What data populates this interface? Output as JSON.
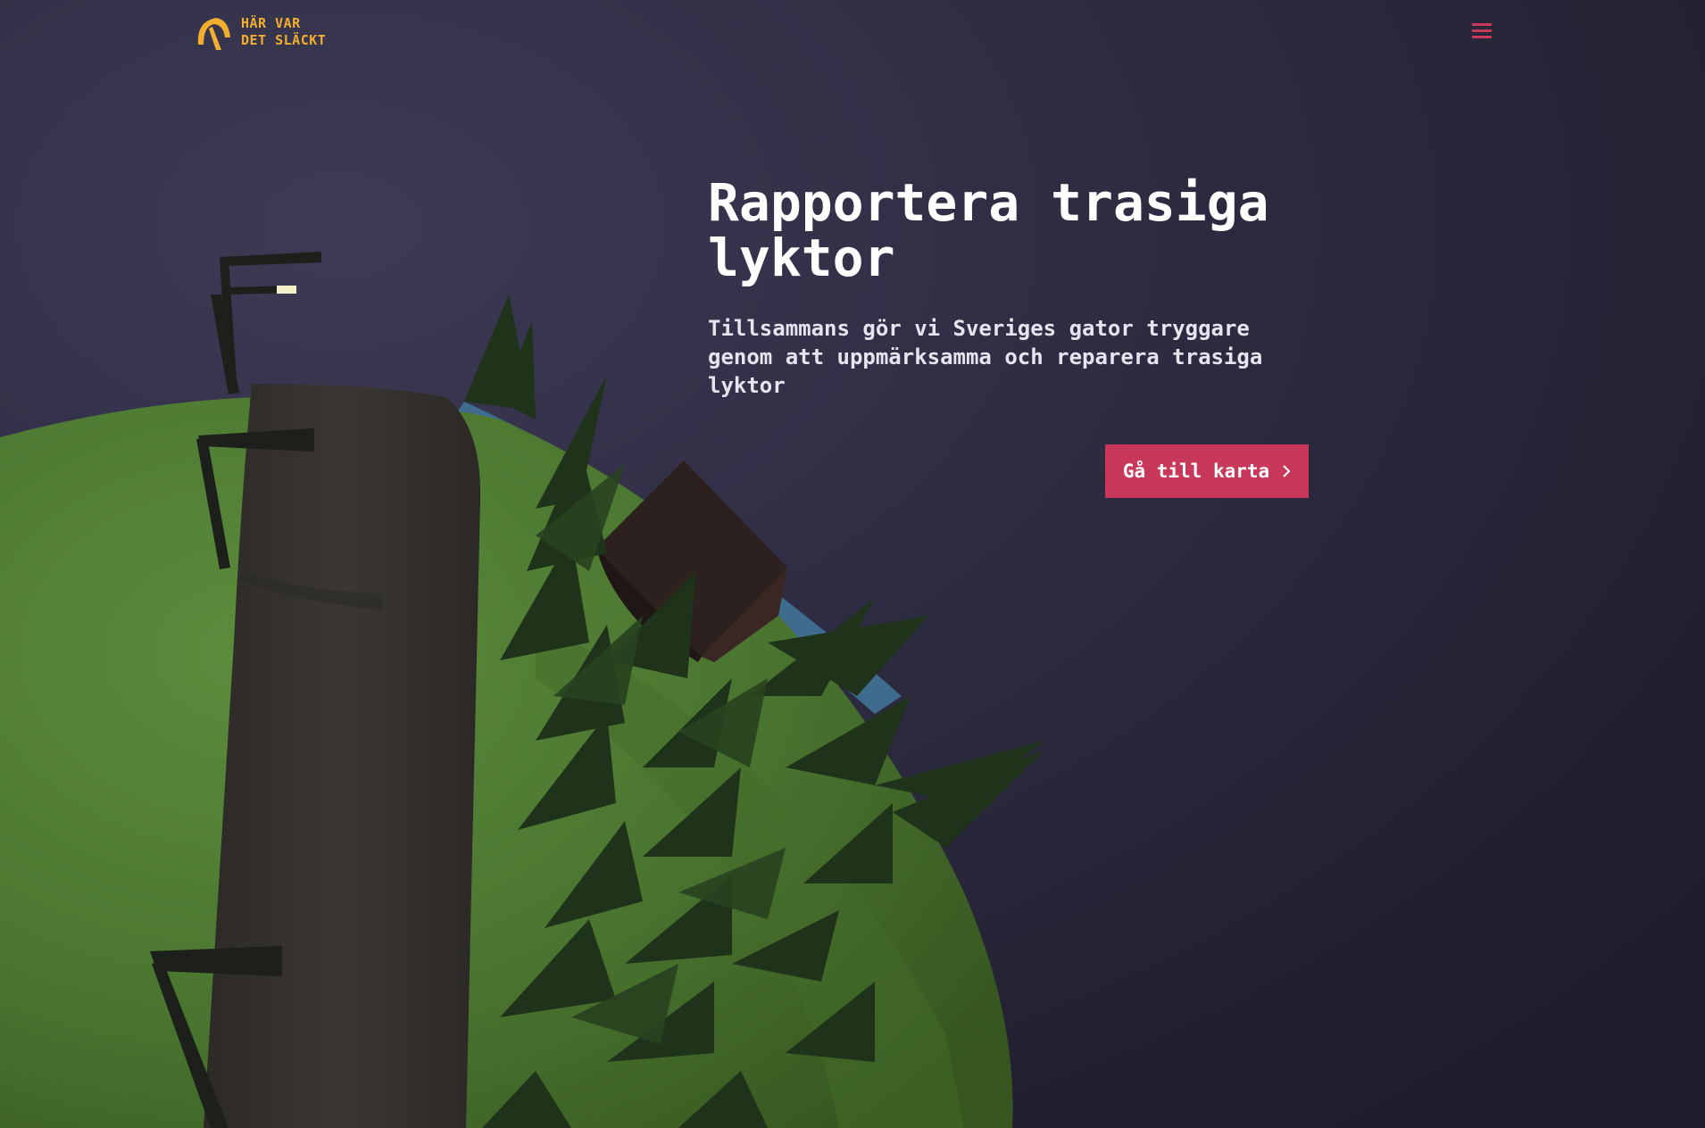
{
  "brand": {
    "line1": "HÄR VAR",
    "line2": "DET SLÄCKT",
    "logo_icon": "lamp-arc-icon",
    "color": "#f2ae2e"
  },
  "nav": {
    "menu_icon": "hamburger-menu-icon",
    "menu_color": "#c8385a"
  },
  "hero": {
    "title": "Rapportera trasiga lyktor",
    "subtitle": "Tillsammans gör vi Sveriges gator tryggare genom att uppmärksamma och reparera trasiga lyktor",
    "cta_label": "Gå till karta",
    "cta_icon": "chevron-right-icon",
    "cta_color": "#c8385a"
  },
  "background": {
    "scene": "low-poly-planet-with-road-streetlamps-trees-and-house",
    "sky_color": "#2e2c42",
    "grass_color": "#4f7a32",
    "road_color": "#38332f"
  }
}
